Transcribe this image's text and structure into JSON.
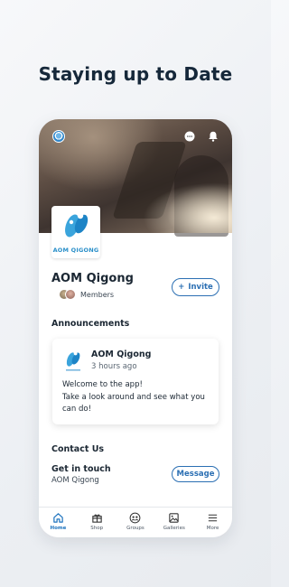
{
  "headline": "Staying up to Date",
  "group": {
    "logo_text": "AOM QIGONG",
    "name": "AOM Qigong",
    "members_label": "Members",
    "invite_label": "Invite"
  },
  "announcements": {
    "title": "Announcements",
    "post": {
      "author": "AOM Qigong",
      "time": "3 hours ago",
      "body_lines": [
        "Welcome to the app!",
        "Take a look around and see what you",
        "can do!"
      ]
    }
  },
  "contact": {
    "title": "Contact Us",
    "subtitle": "Get in touch",
    "name": "AOM Qigong",
    "message_label": "Message"
  },
  "nav": [
    {
      "label": "Home",
      "icon": "home-icon",
      "active": true
    },
    {
      "label": "Shop",
      "icon": "gift-icon",
      "active": false
    },
    {
      "label": "Groups",
      "icon": "groups-icon",
      "active": false
    },
    {
      "label": "Galleries",
      "icon": "gallery-icon",
      "active": false
    },
    {
      "label": "More",
      "icon": "menu-icon",
      "active": false
    }
  ],
  "colors": {
    "accent": "#2b6fb3",
    "active_nav": "#1e73be",
    "logo_blue": "#2a8fc9",
    "headline": "#16283a"
  }
}
